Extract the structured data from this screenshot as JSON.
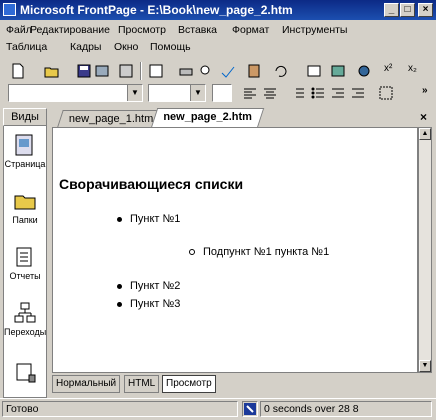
{
  "window": {
    "title": "Microsoft FrontPage - E:\\Book\\new_page_2.htm",
    "min_label": "_",
    "max_label": "□",
    "close_label": "×"
  },
  "menu": [
    "Файл",
    "Редактирование",
    "Просмотр",
    "Вставка",
    "Формат",
    "Инструменты",
    "Таблица",
    "Кадры",
    "Окно",
    "Помощь"
  ],
  "toolbar": {
    "style_value": "",
    "font_value": "",
    "size_value": "",
    "super_label": "x²",
    "sub_label": "x₂"
  },
  "views_panel": {
    "header": "Виды",
    "items": [
      "Страница",
      "Папки",
      "Отчеты",
      "Переходы",
      ""
    ]
  },
  "tabs": [
    "new_page_1.htm",
    "new_page_2.htm"
  ],
  "document": {
    "heading": "Сворачивающиеся списки",
    "items": [
      {
        "text": "Пункт №1",
        "level": 1
      },
      {
        "text": "Подпункт №1 пункта №1",
        "level": 2
      },
      {
        "text": "Пункт №2",
        "level": 1
      },
      {
        "text": "Пункт №3",
        "level": 1
      }
    ]
  },
  "view_tabs": [
    "Нормальный",
    "HTML",
    "Просмотр"
  ],
  "status": {
    "left": "Готово",
    "timing": "0 seconds over 28 8"
  },
  "colors": {
    "titlebar": "#0c2a86",
    "face": "#d4d0c8"
  }
}
